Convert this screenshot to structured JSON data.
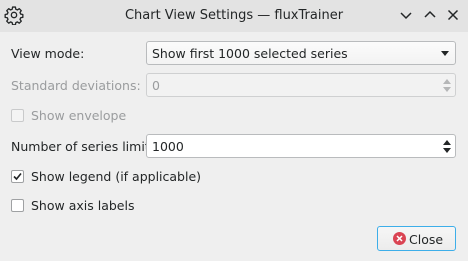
{
  "window": {
    "title": "Chart View Settings — fluxTrainer",
    "icons": {
      "app": "gear-icon",
      "minimize": "chevron-down-icon",
      "maximize": "chevron-up-icon",
      "close": "close-icon"
    }
  },
  "form": {
    "view_mode": {
      "label": "View mode:",
      "value": "Show first 1000 selected series"
    },
    "std_dev": {
      "label": "Standard deviations:",
      "value": "0",
      "enabled": false
    },
    "show_envelope": {
      "label": "Show envelope",
      "checked": false,
      "enabled": false
    },
    "series_limit": {
      "label": "Number of series limit:",
      "value": "1000"
    },
    "show_legend": {
      "label": "Show legend (if applicable)",
      "checked": true
    },
    "show_axis_labels": {
      "label": "Show axis labels",
      "checked": false
    }
  },
  "buttons": {
    "close_label": "Close"
  },
  "colors": {
    "accent": "#3daee9",
    "close_icon": "#da4453",
    "disabled_text": "#9a9c9e"
  }
}
